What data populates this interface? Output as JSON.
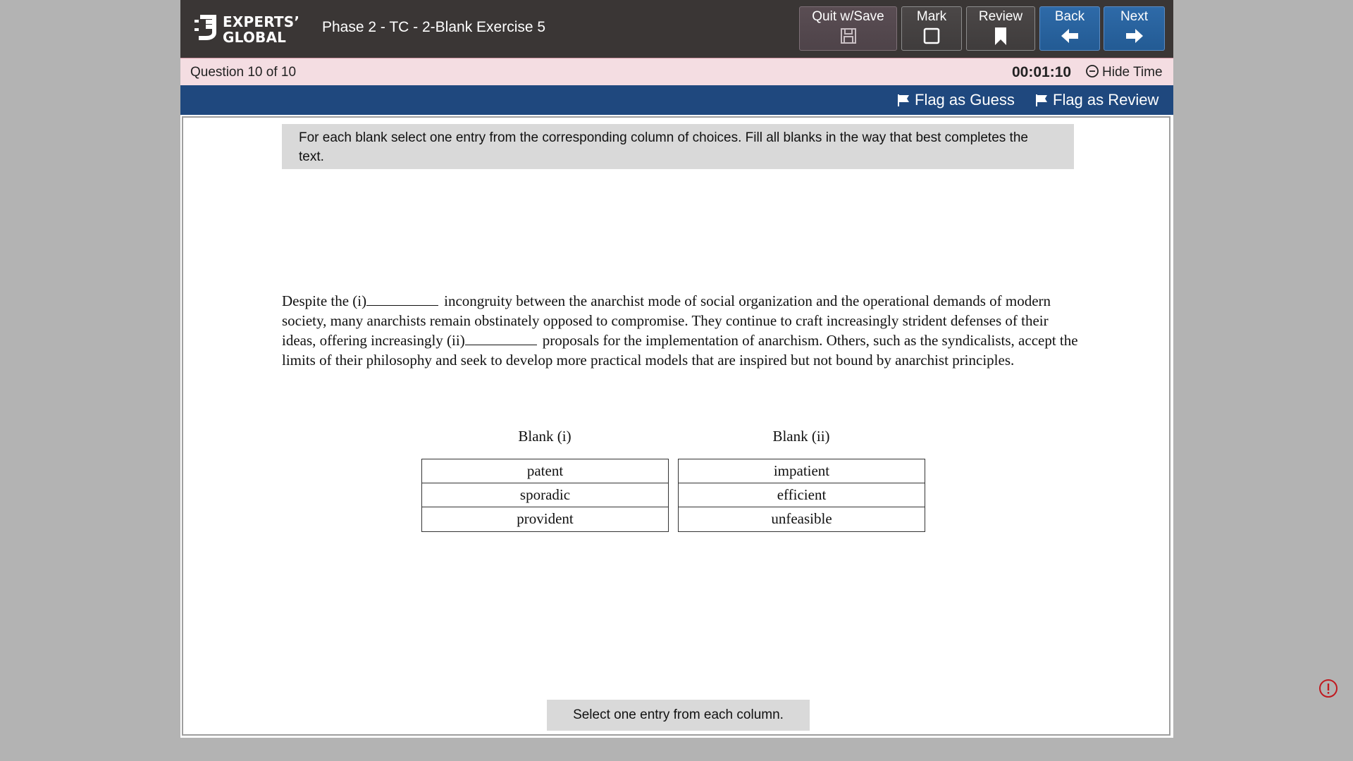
{
  "header": {
    "logo_line1": "EXPERTS’",
    "logo_line2": "GLOBAL",
    "title": "Phase 2 - TC - 2-Blank Exercise 5",
    "buttons": {
      "quit": "Quit w/Save",
      "mark": "Mark",
      "review": "Review",
      "back": "Back",
      "next": "Next"
    }
  },
  "question_bar": {
    "label": "Question",
    "current": "10",
    "of": "of",
    "total": "10",
    "timer": "00:01:10",
    "hide_time": "Hide Time"
  },
  "flag_bar": {
    "guess": "Flag as Guess",
    "review": "Flag as Review"
  },
  "instructions": "For each blank select one entry from the corresponding column of choices. Fill all blanks in the way that best completes the text.",
  "passage": {
    "part1": "Despite the (i)",
    "part2": "incongruity between the anarchist mode of social organization and the operational demands of modern society, many anarchists remain obstinately opposed to compromise. They continue to craft increasingly strident defenses of their ideas, offering increasingly (ii)",
    "part3": "proposals for the implementation of anarchism. Others, such as the syndicalists, accept the limits of their philosophy and seek to develop more practical models that are inspired but not bound by anarchist principles."
  },
  "blank1": {
    "heading": "Blank (i)",
    "options": [
      "patent",
      "sporadic",
      "provident"
    ]
  },
  "blank2": {
    "heading": "Blank (ii)",
    "options": [
      "impatient",
      "efficient",
      "unfeasible"
    ]
  },
  "status_message": "Select one entry from each column.",
  "colors": {
    "header_bg": "#3a3635",
    "flag_bar_bg": "#1f487e",
    "question_bar_bg": "#f4dde2",
    "nav_blue": "#2e6aa8",
    "alert_red": "#c0191f"
  }
}
